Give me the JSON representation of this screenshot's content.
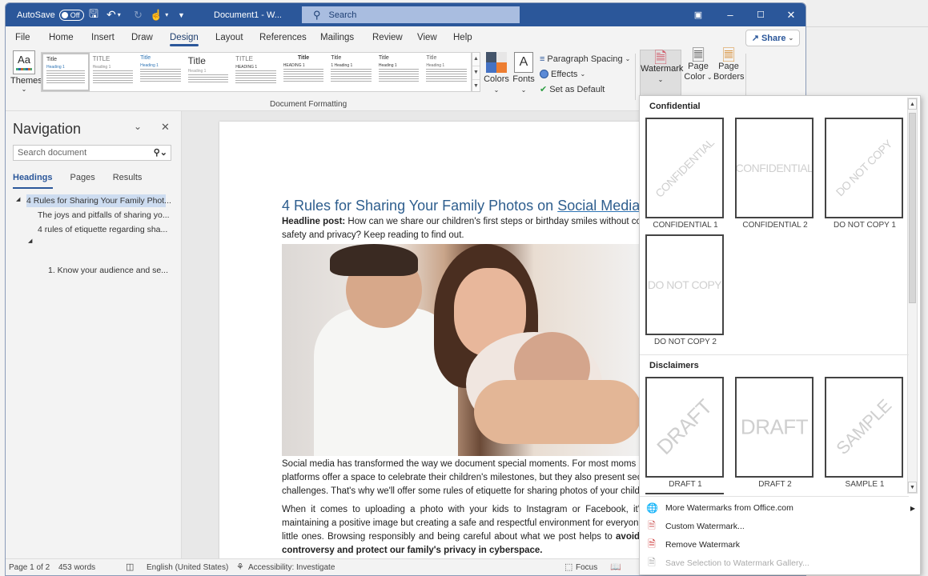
{
  "titlebar": {
    "autosave_label": "AutoSave",
    "autosave_state": "Off",
    "doc_title": "Document1 - W...",
    "search_placeholder": "Search",
    "icons": [
      "save-icon",
      "undo-icon",
      "redo-icon",
      "touch-mode-icon",
      "customize-qat-icon"
    ],
    "window_controls": [
      "ribbon-display-icon",
      "minimize-icon",
      "maximize-icon",
      "close-icon"
    ]
  },
  "tabs": [
    {
      "label": "File"
    },
    {
      "label": "Home"
    },
    {
      "label": "Insert"
    },
    {
      "label": "Draw"
    },
    {
      "label": "Design",
      "active": true
    },
    {
      "label": "Layout"
    },
    {
      "label": "References"
    },
    {
      "label": "Mailings"
    },
    {
      "label": "Review"
    },
    {
      "label": "View"
    },
    {
      "label": "Help"
    }
  ],
  "share": {
    "label": "Share"
  },
  "ribbon": {
    "themes_label": "Themes",
    "style_gallery": [
      {
        "title": "Title",
        "heading": "Heading 1"
      },
      {
        "title": "TITLE",
        "heading": "Heading 1"
      },
      {
        "title": "Title",
        "heading": "Heading 1"
      },
      {
        "title": "Title",
        "heading": "Heading 1"
      },
      {
        "title": "TITLE",
        "heading": "HEADING 1"
      },
      {
        "title": "Title",
        "heading": "HEADING 1"
      },
      {
        "title": "Title",
        "heading": "1 Heading 1"
      },
      {
        "title": "Title",
        "heading": "Heading 1"
      },
      {
        "title": "Title",
        "heading": "Heading 1"
      }
    ],
    "group_label": "Document Formatting",
    "colors_label": "Colors",
    "fonts_label": "Fonts",
    "paragraph_spacing_label": "Paragraph Spacing",
    "effects_label": "Effects",
    "set_default_label": "Set as Default",
    "watermark_label": "Watermark",
    "page_color_label_1": "Page",
    "page_color_label_2": "Color",
    "page_borders_label_1": "Page",
    "page_borders_label_2": "Borders",
    "colors": {
      "accent": "#2b579a",
      "swatch1": "#44546a",
      "swatch2": "#e7e6e6",
      "swatch3": "#4472c4",
      "swatch4": "#ed7d31"
    }
  },
  "navigation": {
    "title": "Navigation",
    "search_placeholder": "Search document",
    "tabs": [
      "Headings",
      "Pages",
      "Results"
    ],
    "items": [
      {
        "label": "4 Rules for Sharing Your Family Phot...",
        "level": 1,
        "selected": true
      },
      {
        "label": "The joys and pitfalls of sharing yo...",
        "level": 2
      },
      {
        "label": "4 rules of etiquette regarding sha...",
        "level": 2
      },
      {
        "label": "",
        "level": 2,
        "collapsible": true
      },
      {
        "label": "1. Know your audience and se...",
        "level": 3
      }
    ]
  },
  "document": {
    "heading_part1": "4 Rules for Sharing Your Family Photos on ",
    "heading_part2": "Social Media",
    "headline_bold": "Headline post:",
    "headline_text": " How can we share our children's first steps or birthday smiles without comp",
    "headline_text2": "safety and privacy? Keep reading to find out.",
    "image_alt": "Family photo: father and mother smiling at a baby",
    "para1": [
      "Social media has transformed the way we document special moments. For most moms ar",
      "platforms offer a space to celebrate their children's milestones, but they also present securi",
      "challenges. That's why we'll offer some rules of etiquette for sharing photos of your childre"
    ],
    "para2": [
      "When it comes to uploading a photo with your kids to Instagram or Facebook, it's n",
      "maintaining a positive image but creating a safe and respectful environment for everyone,"
    ],
    "para2_line3_normal": "little ones. Browsing responsibly and being careful about what we post helps to ",
    "para2_line3_bold": "avoid",
    "para2_line4_bold": "controversy and protect our family's privacy in cyberspace."
  },
  "watermark_menu": {
    "sections": [
      {
        "title": "Confidential",
        "items": [
          {
            "label": "CONFIDENTIAL 1",
            "text": "CONFIDENTIAL",
            "style": "diagonal"
          },
          {
            "label": "CONFIDENTIAL 2",
            "text": "CONFIDENTIAL",
            "style": "horizontal"
          },
          {
            "label": "DO NOT COPY 1",
            "text": "DO NOT COPY",
            "style": "diagonal"
          },
          {
            "label": "DO NOT COPY 2",
            "text": "DO NOT COPY",
            "style": "horizontal"
          }
        ]
      },
      {
        "title": "Disclaimers",
        "items": [
          {
            "label": "DRAFT 1",
            "text": "DRAFT",
            "style": "diagonal"
          },
          {
            "label": "DRAFT 2",
            "text": "DRAFT",
            "style": "horizontal"
          },
          {
            "label": "SAMPLE 1",
            "text": "SAMPLE",
            "style": "diagonal"
          }
        ]
      }
    ],
    "commands": [
      {
        "label": "More Watermarks from Office.com",
        "icon": "globe-icon",
        "submenu": true,
        "enabled": true
      },
      {
        "label": "Custom Watermark...",
        "icon": "custom-watermark-icon",
        "enabled": true
      },
      {
        "label": "Remove Watermark",
        "icon": "remove-watermark-icon",
        "enabled": true
      },
      {
        "label": "Save Selection to Watermark Gallery...",
        "icon": "save-gallery-icon",
        "enabled": false
      }
    ]
  },
  "status": {
    "page": "Page 1 of 2",
    "words": "453 words",
    "language": "English (United States)",
    "accessibility": "Accessibility: Investigate",
    "focus": "Focus"
  }
}
